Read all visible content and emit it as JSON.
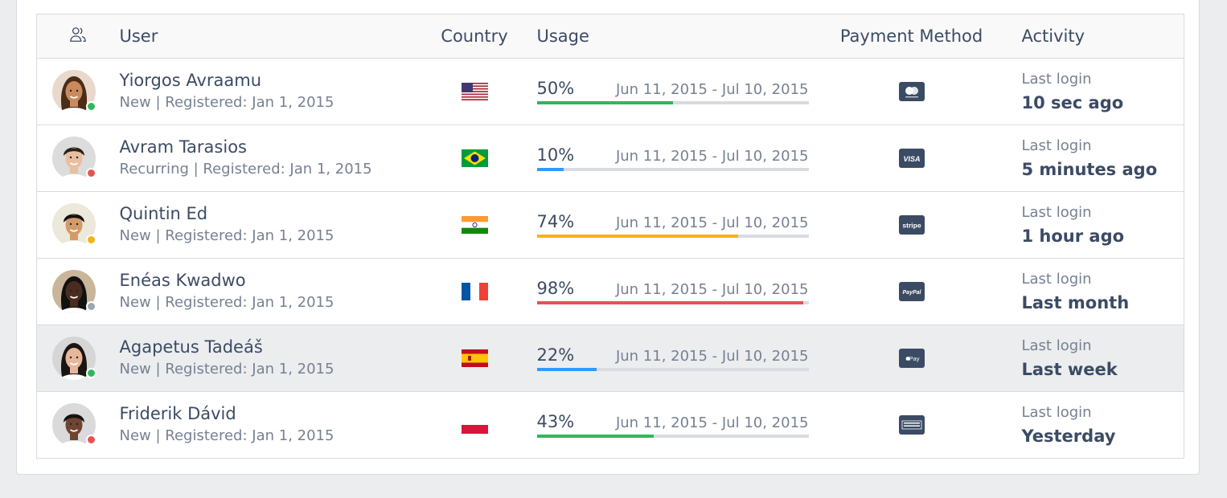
{
  "headers": {
    "user": "User",
    "country": "Country",
    "usage": "Usage",
    "payment": "Payment Method",
    "activity": "Activity",
    "icon": "users-icon"
  },
  "colors": {
    "success": "#2eb85c",
    "info": "#39f",
    "warning": "#f9b115",
    "danger": "#e55353",
    "secondary": "#9da5b1"
  },
  "rows": [
    {
      "name": "Yiorgos Avraamu",
      "sub": "New | Registered: Jan 1, 2015",
      "status": "success",
      "country_flag": "us-flag-icon",
      "usage_pct": "50%",
      "usage_value": 50,
      "usage_color": "success",
      "range": "Jun 11, 2015 - Jul 10, 2015",
      "payment_icon": "mastercard-icon",
      "activity_label": "Last login",
      "activity_value": "10 sec ago"
    },
    {
      "name": "Avram Tarasios",
      "sub": "Recurring | Registered: Jan 1, 2015",
      "status": "danger",
      "country_flag": "brazil-flag-icon",
      "usage_pct": "10%",
      "usage_value": 10,
      "usage_color": "info",
      "range": "Jun 11, 2015 - Jul 10, 2015",
      "payment_icon": "visa-icon",
      "activity_label": "Last login",
      "activity_value": "5 minutes ago"
    },
    {
      "name": "Quintin Ed",
      "sub": "New | Registered: Jan 1, 2015",
      "status": "warning",
      "country_flag": "india-flag-icon",
      "usage_pct": "74%",
      "usage_value": 74,
      "usage_color": "warning",
      "range": "Jun 11, 2015 - Jul 10, 2015",
      "payment_icon": "stripe-icon",
      "activity_label": "Last login",
      "activity_value": "1 hour ago"
    },
    {
      "name": "Enéas Kwadwo",
      "sub": "New | Registered: Jan 1, 2015",
      "status": "secondary",
      "country_flag": "france-flag-icon",
      "usage_pct": "98%",
      "usage_value": 98,
      "usage_color": "danger",
      "range": "Jun 11, 2015 - Jul 10, 2015",
      "payment_icon": "paypal-icon",
      "activity_label": "Last login",
      "activity_value": "Last month"
    },
    {
      "name": "Agapetus Tadeáš",
      "sub": "New | Registered: Jan 1, 2015",
      "status": "success",
      "country_flag": "spain-flag-icon",
      "usage_pct": "22%",
      "usage_value": 22,
      "usage_color": "info",
      "range": "Jun 11, 2015 - Jul 10, 2015",
      "payment_icon": "apple-pay-icon",
      "activity_label": "Last login",
      "activity_value": "Last week"
    },
    {
      "name": "Friderik Dávid",
      "sub": "New | Registered: Jan 1, 2015",
      "status": "danger",
      "country_flag": "poland-flag-icon",
      "usage_pct": "43%",
      "usage_value": 43,
      "usage_color": "success",
      "range": "Jun 11, 2015 - Jul 10, 2015",
      "payment_icon": "amex-icon",
      "activity_label": "Last login",
      "activity_value": "Yesterday"
    }
  ]
}
